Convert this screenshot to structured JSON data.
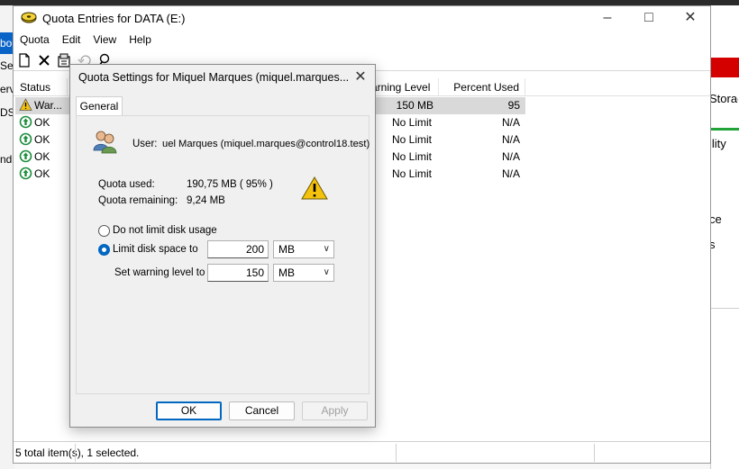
{
  "background": {
    "left_fragments": [
      "bo",
      "Se",
      "erv",
      "DS",
      "nd"
    ],
    "right_fragments": [
      "Storac",
      "ility",
      "ce",
      "s"
    ]
  },
  "main_window": {
    "title": "Quota Entries for DATA (E:)",
    "menu": [
      "Quota",
      "Edit",
      "View",
      "Help"
    ],
    "columns": [
      "Status",
      "arning Level",
      "Percent Used"
    ],
    "rows": [
      {
        "status": "War...",
        "status_type": "warning",
        "warning_level": "150 MB",
        "percent_used": "95",
        "selected": true
      },
      {
        "status": "OK",
        "status_type": "ok",
        "warning_level": "No Limit",
        "percent_used": "N/A",
        "selected": false
      },
      {
        "status": "OK",
        "status_type": "ok",
        "warning_level": "No Limit",
        "percent_used": "N/A",
        "selected": false
      },
      {
        "status": "OK",
        "status_type": "ok",
        "warning_level": "No Limit",
        "percent_used": "N/A",
        "selected": false
      },
      {
        "status": "OK",
        "status_type": "ok",
        "warning_level": "No Limit",
        "percent_used": "N/A",
        "selected": false
      }
    ],
    "status_text": "5 total item(s), 1 selected."
  },
  "dialog": {
    "title": "Quota Settings for Miquel Marques (miquel.marques...",
    "tab": "General",
    "user_label": "User:",
    "user_value": "uel Marques (miquel.marques@control18.test)",
    "quota_used_label": "Quota used:",
    "quota_used_value": "190,75 MB ( 95% )",
    "quota_remaining_label": "Quota remaining:",
    "quota_remaining_value": "9,24 MB",
    "no_limit_label": "Do not limit disk usage",
    "limit_label": "Limit disk space to",
    "limit_value": "200",
    "limit_unit": "MB",
    "warning_label": "Set warning level to",
    "warning_value": "150",
    "warning_unit": "MB",
    "ok": "OK",
    "cancel": "Cancel",
    "apply": "Apply"
  },
  "colors": {
    "selection": "#d9d9d9",
    "accent": "#0067c0",
    "warning_yellow": "#f4c20d",
    "ok_green": "#1e8e3e"
  }
}
